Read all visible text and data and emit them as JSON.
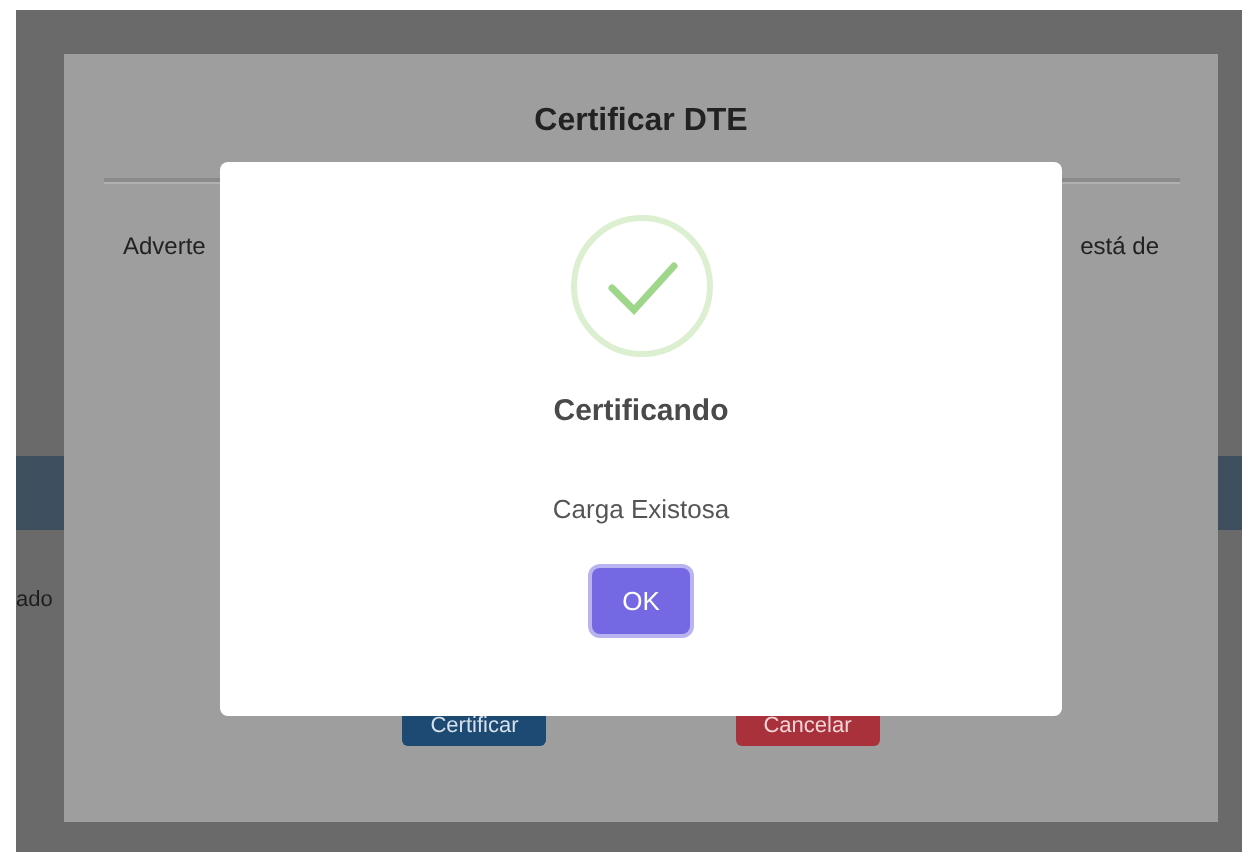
{
  "background_page": {
    "side_text": "ado"
  },
  "modal": {
    "title": "Certificar DTE",
    "text_left": "Adverte",
    "text_right": "está de",
    "buttons": [
      {
        "label": "Certificar",
        "kind": "primary"
      },
      {
        "label": "Cancelar",
        "kind": "danger"
      }
    ]
  },
  "alert": {
    "kind": "success",
    "title": "Certificando",
    "message": "Carga Existosa",
    "confirm_button": "OK"
  }
}
